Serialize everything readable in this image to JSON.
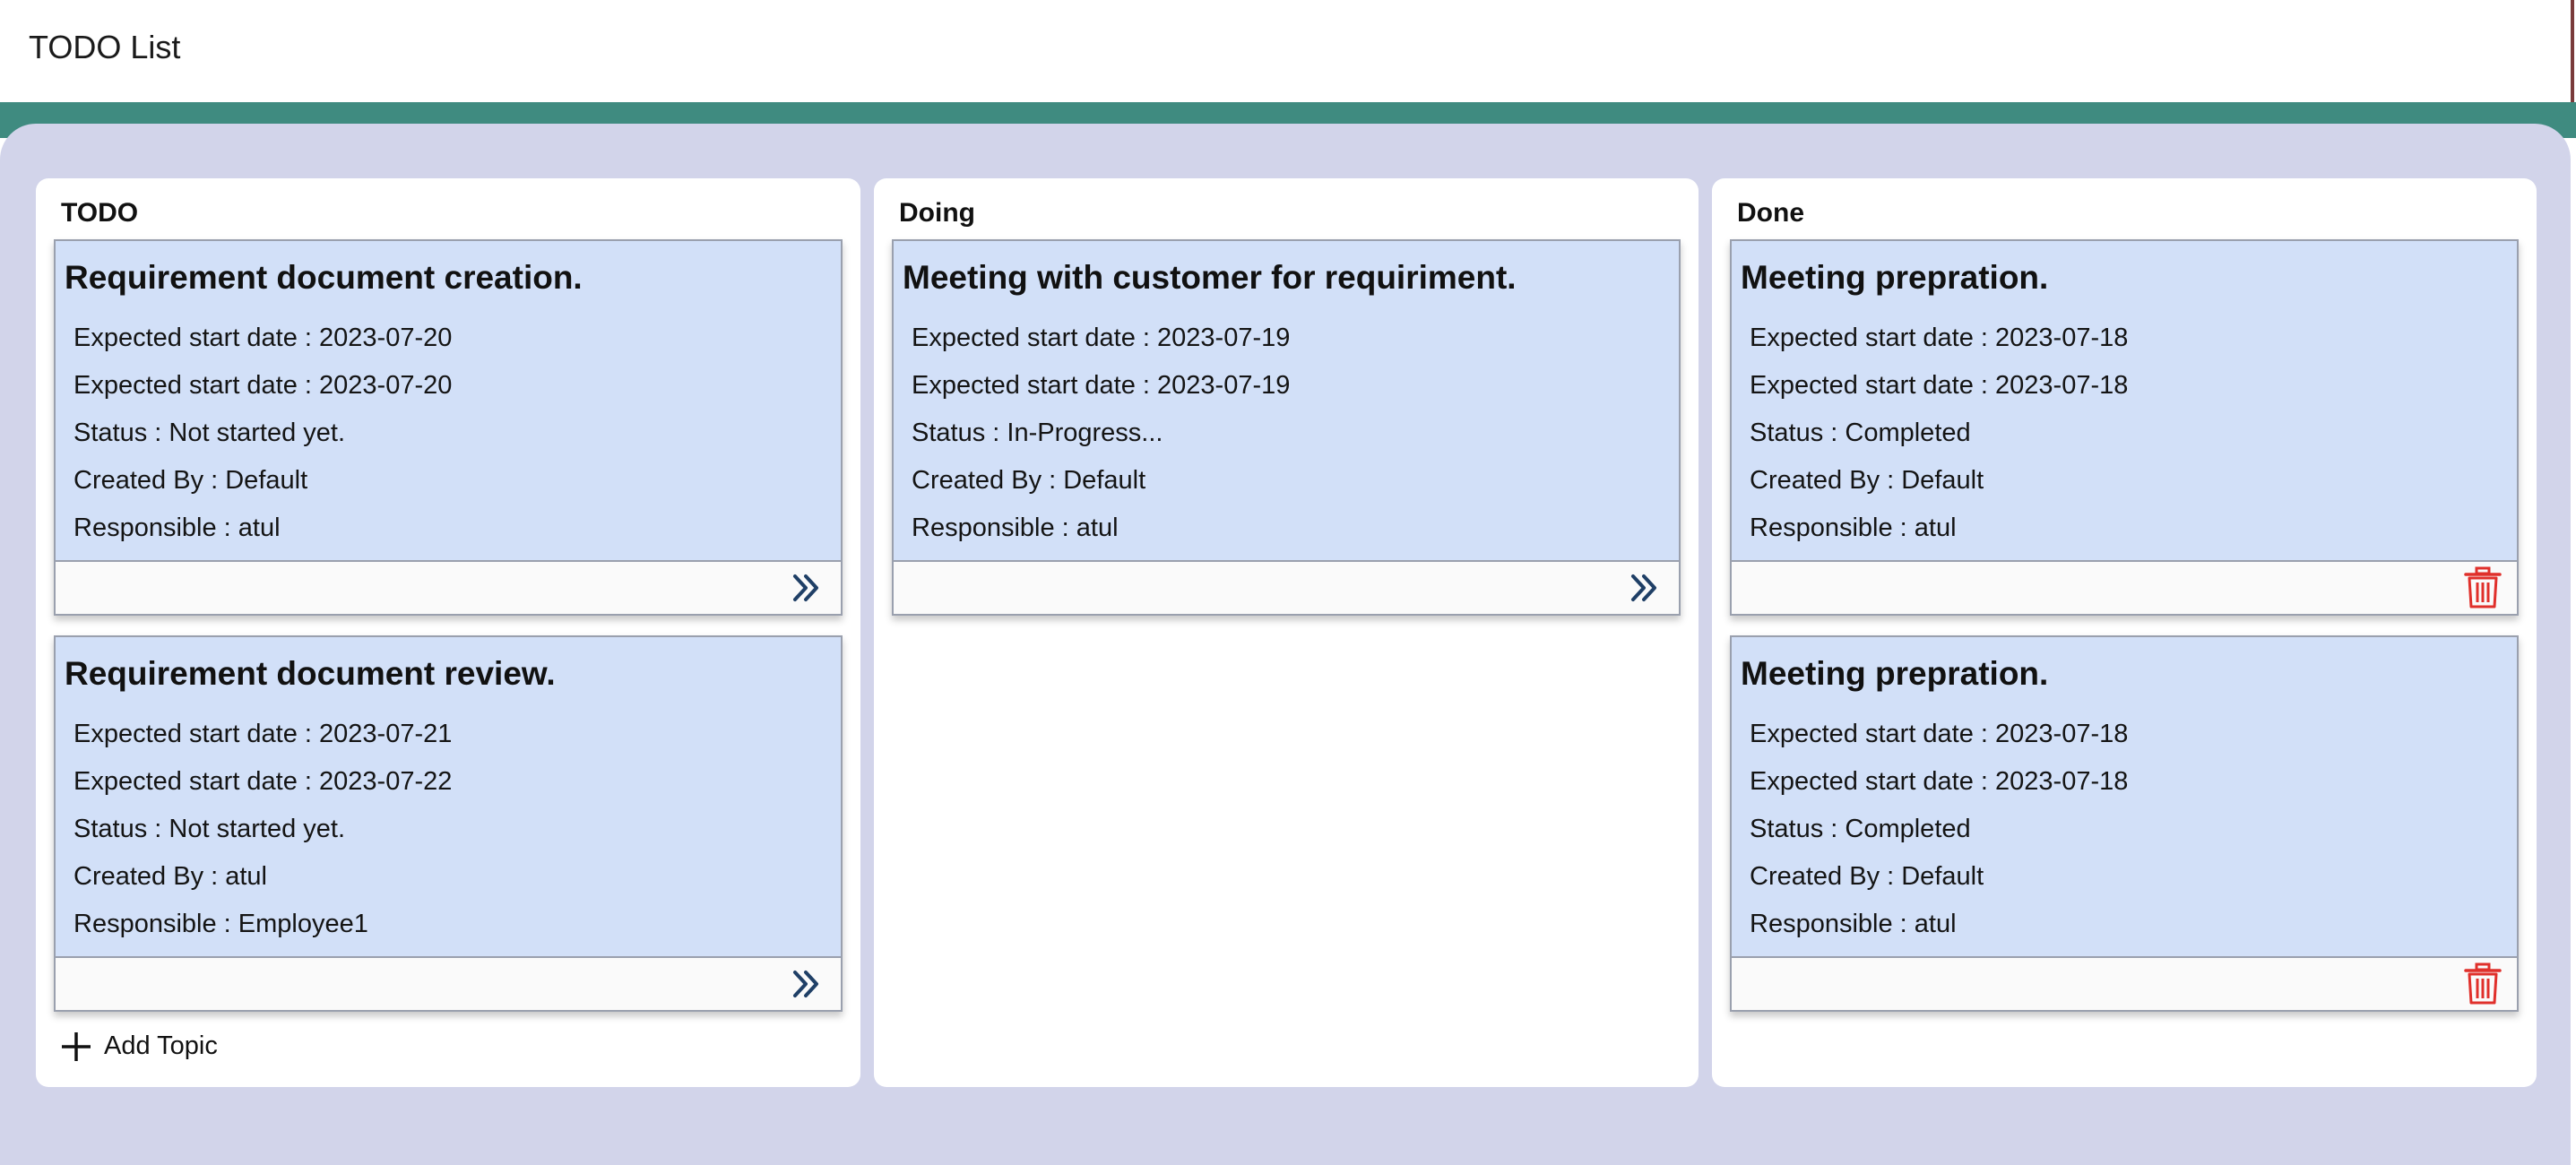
{
  "app": {
    "title": "TODO List"
  },
  "colors": {
    "header_band": "#3f8b80",
    "board_background": "#d2d4ea",
    "card_background": "#d2e0f8",
    "move_icon": "#1f3f66",
    "delete_icon": "#e0302b"
  },
  "columns": [
    {
      "title": "TODO",
      "cards": [
        {
          "title": "Requirement document creation.",
          "lines": [
            "Expected start date : 2023-07-20",
            "Expected start date : 2023-07-20",
            "Status : Not started yet.",
            "Created By : Default",
            "Responsible : atul"
          ],
          "action_icon": "double-chevron-right-icon"
        },
        {
          "title": "Requirement document review.",
          "lines": [
            "Expected start date : 2023-07-21",
            "Expected start date : 2023-07-22",
            "Status : Not started yet.",
            "Created By : atul",
            "Responsible : Employee1"
          ],
          "action_icon": "double-chevron-right-icon"
        }
      ],
      "add_topic_label": "Add Topic"
    },
    {
      "title": "Doing",
      "cards": [
        {
          "title": "Meeting with customer for requiriment.",
          "lines": [
            "Expected start date : 2023-07-19",
            "Expected start date : 2023-07-19",
            "Status : In-Progress...",
            "Created By : Default",
            "Responsible : atul"
          ],
          "action_icon": "double-chevron-right-icon"
        }
      ]
    },
    {
      "title": "Done",
      "cards": [
        {
          "title": "Meeting prepration.",
          "lines": [
            "Expected start date : 2023-07-18",
            "Expected start date : 2023-07-18",
            "Status : Completed",
            "Created By : Default",
            "Responsible : atul"
          ],
          "action_icon": "trash-icon"
        },
        {
          "title": "Meeting prepration.",
          "lines": [
            "Expected start date : 2023-07-18",
            "Expected start date : 2023-07-18",
            "Status : Completed",
            "Created By : Default",
            "Responsible : atul"
          ],
          "action_icon": "trash-icon"
        }
      ]
    }
  ]
}
